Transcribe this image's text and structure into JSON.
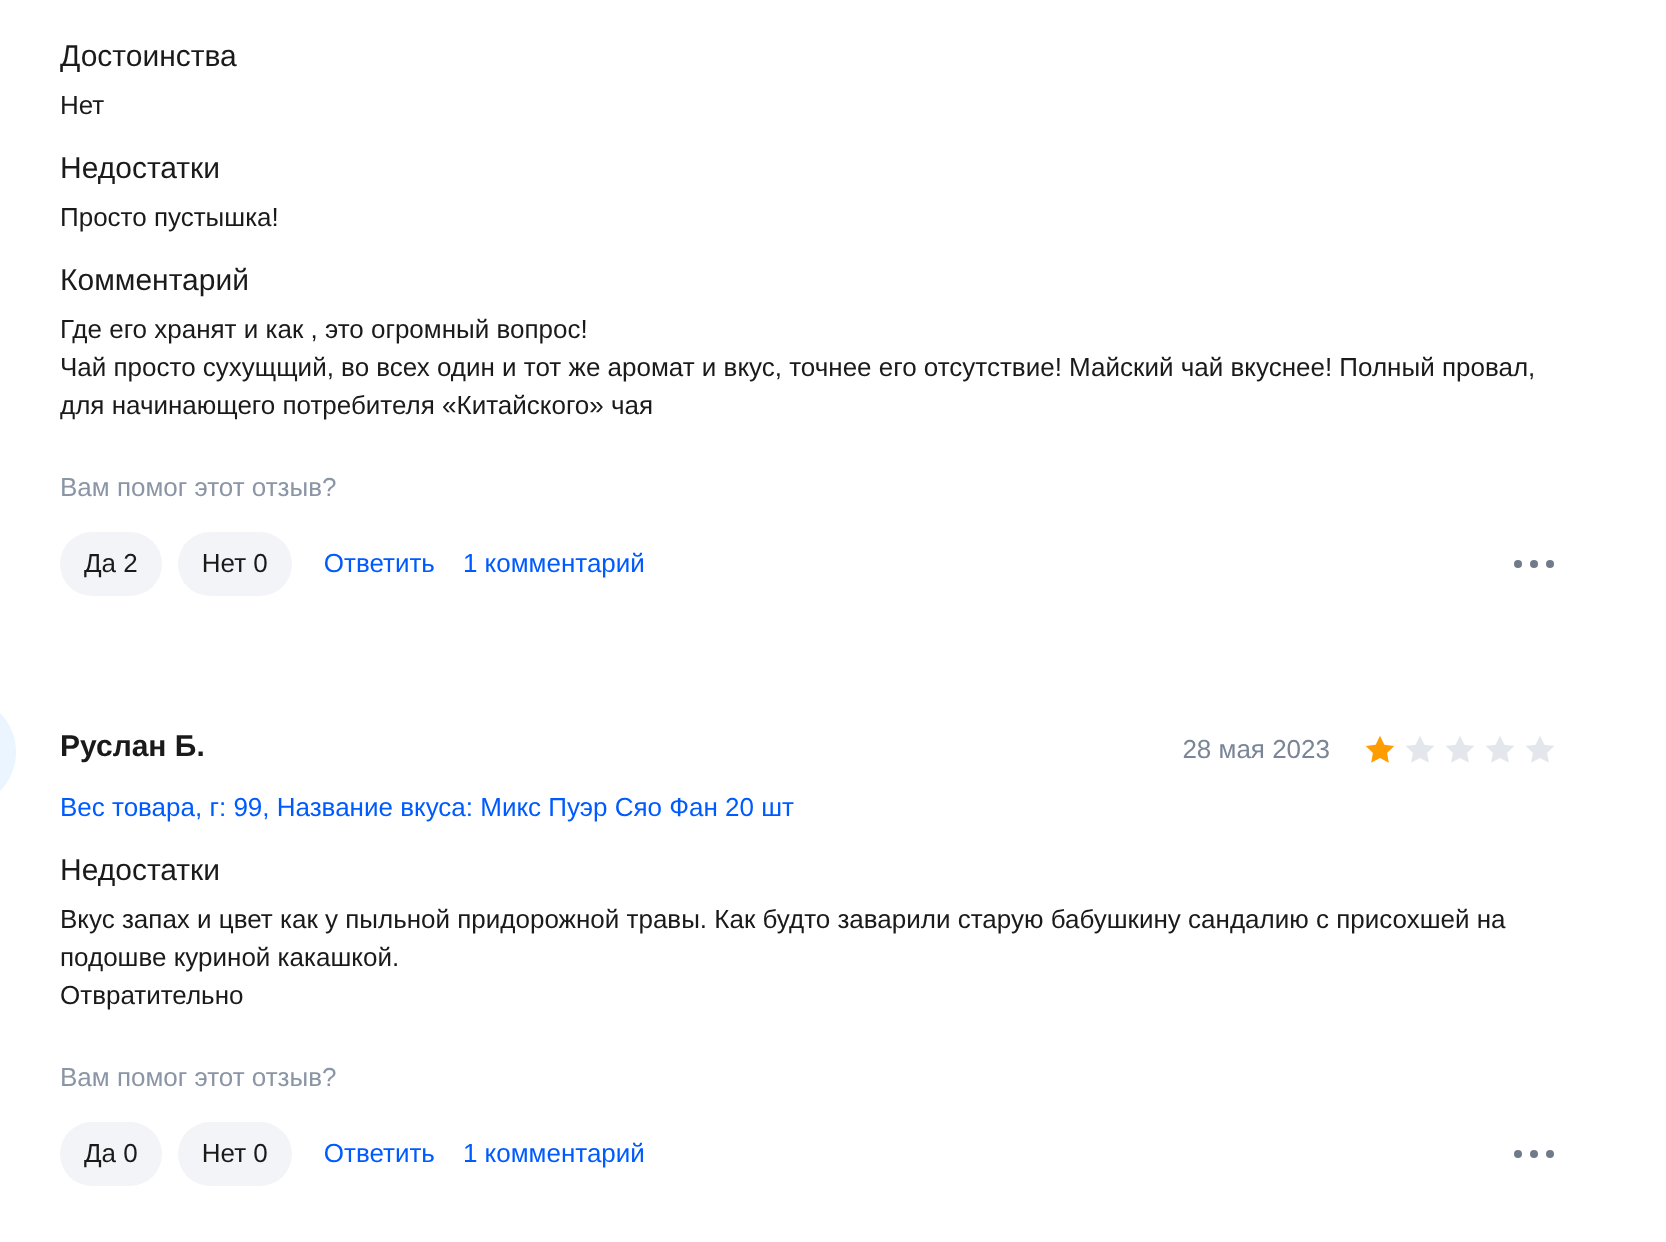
{
  "reviews": [
    {
      "sections": [
        {
          "title": "Достоинства",
          "text": "Нет"
        },
        {
          "title": "Недостатки",
          "text": "Просто пустышка!"
        },
        {
          "title": "Комментарий",
          "text": "Где его хранят и как , это огромный вопрос!\nЧай просто сухущщий, во всех один и тот же аромат и вкус, точнее его отсутствие! Майский чай вкуснее! Полный провал, для начинающего потребителя «Китайского» чая"
        }
      ],
      "helpful_question": "Вам помог этот отзыв?",
      "yes_button": "Да 2",
      "no_button": "Нет 0",
      "reply_link": "Ответить",
      "comments_link": "1 комментарий"
    },
    {
      "author": "Руслан Б.",
      "date": "28 мая 2023",
      "stars": 1,
      "variant": "Вес товара, г: 99, Название вкуса: Микс Пуэр Сяо Фан 20 шт",
      "sections": [
        {
          "title": "Недостатки",
          "text": "Вкус запах и цвет как у пыльной придорожной травы. Как будто заварили старую бабушкину сандалию с присохшей на подошве куриной какашкой.\nОтвратительно"
        }
      ],
      "helpful_question": "Вам помог этот отзыв?",
      "yes_button": "Да 0",
      "no_button": "Нет 0",
      "reply_link": "Ответить",
      "comments_link": "1 комментарий"
    }
  ]
}
